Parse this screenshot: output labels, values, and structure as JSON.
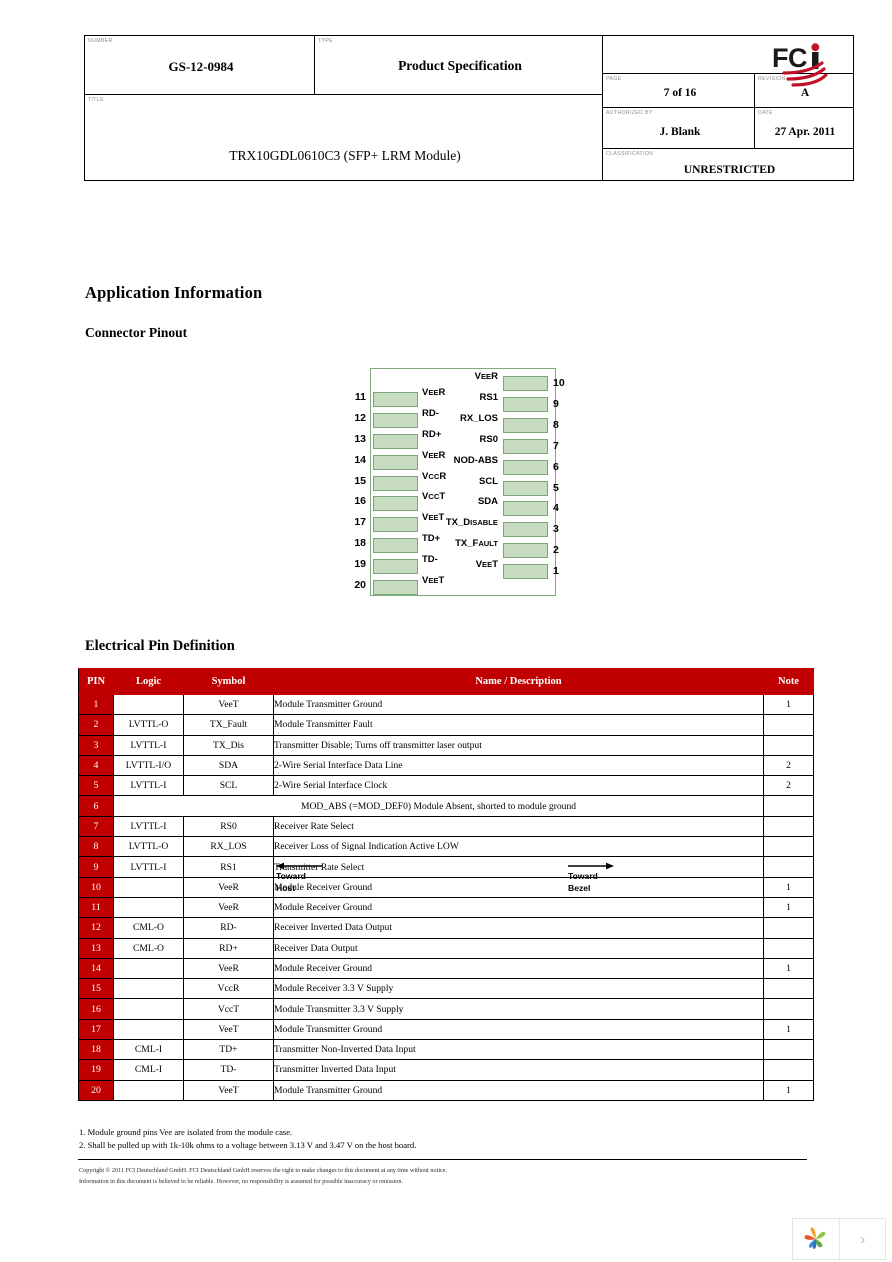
{
  "header": {
    "number_label": "NUMBER",
    "number_value": "GS-12-0984",
    "type_label": "TYPE",
    "type_value": "Product Specification",
    "title_label": "TITLE",
    "title_value": "TRX10GDL0610C3 (SFP+ LRM Module)",
    "page_label": "PAGE",
    "page_value": "7 of 16",
    "revision_label": "REVISION",
    "revision_value": "A",
    "authorized_label": "AUTHORIZED BY",
    "authorized_value": "J. Blank",
    "date_label": "DATE",
    "date_value": "27 Apr. 2011",
    "classification_label": "CLASSIFICATION",
    "classification_value": "UNRESTRICTED",
    "logo_text": "FCI"
  },
  "sections": {
    "application_information": "Application Information",
    "connector_pinout": "Connector Pinout",
    "electrical_pin_definition": "Electrical Pin Definition"
  },
  "pinout": {
    "toward_host_line1": "Toward",
    "toward_host_line2": "Host",
    "toward_bezel_line1": "Toward",
    "toward_bezel_line2": "Bezel",
    "pad_color": "#c8dcc2",
    "pad_border_color": "#7ba676",
    "left_pins": [
      {
        "num": "11",
        "label": "VeeR"
      },
      {
        "num": "12",
        "label": "RD-"
      },
      {
        "num": "13",
        "label": "RD+"
      },
      {
        "num": "14",
        "label": "VeeR"
      },
      {
        "num": "15",
        "label": "VccR"
      },
      {
        "num": "16",
        "label": "VccT"
      },
      {
        "num": "17",
        "label": "VeeT"
      },
      {
        "num": "18",
        "label": "TD+"
      },
      {
        "num": "19",
        "label": "TD-"
      },
      {
        "num": "20",
        "label": "VeeT"
      }
    ],
    "right_pins": [
      {
        "num": "10",
        "label": "VeeR"
      },
      {
        "num": "9",
        "label": "RS1"
      },
      {
        "num": "8",
        "label": "RX_LOS"
      },
      {
        "num": "7",
        "label": "RS0"
      },
      {
        "num": "6",
        "label": "NOD-ABS"
      },
      {
        "num": "5",
        "label": "SCL"
      },
      {
        "num": "4",
        "label": "SDA"
      },
      {
        "num": "3",
        "label": "TX_Disable"
      },
      {
        "num": "2",
        "label": "TX_Fault"
      },
      {
        "num": "1",
        "label": "VeeT"
      }
    ]
  },
  "pin_table": {
    "header_color": "#c00000",
    "columns": [
      "PIN",
      "Logic",
      "Symbol",
      "Name / Description",
      "Note"
    ],
    "rows": [
      {
        "pin": "1",
        "logic": "",
        "symbol": "VeeT",
        "name": "Module Transmitter Ground",
        "note": "1"
      },
      {
        "pin": "2",
        "logic": "LVTTL-O",
        "symbol": "TX_Fault",
        "name": "Module Transmitter Fault",
        "note": ""
      },
      {
        "pin": "3",
        "logic": "LVTTL-I",
        "symbol": "TX_Dis",
        "name": "Transmitter Disable; Turns off transmitter laser output",
        "note": ""
      },
      {
        "pin": "4",
        "logic": "LVTTL-I/O",
        "symbol": "SDA",
        "name": "2-Wire Serial Interface Data Line",
        "note": "2"
      },
      {
        "pin": "5",
        "logic": "LVTTL-I",
        "symbol": "SCL",
        "name": "2-Wire Serial Interface Clock",
        "note": "2"
      },
      {
        "pin": "6",
        "logic": "",
        "symbol": "",
        "name": "",
        "note": "",
        "span_text": "MOD_ABS  (=MOD_DEF0) Module Absent, shorted to module ground",
        "span": true
      },
      {
        "pin": "7",
        "logic": "LVTTL-I",
        "symbol": "RS0",
        "name": "Receiver Rate Select",
        "note": ""
      },
      {
        "pin": "8",
        "logic": "LVTTL-O",
        "symbol": "RX_LOS",
        "name": "Receiver Loss of Signal Indication Active LOW",
        "note": ""
      },
      {
        "pin": "9",
        "logic": "LVTTL-I",
        "symbol": "RS1",
        "name": "Transmitter Rate Select",
        "note": ""
      },
      {
        "pin": "10",
        "logic": "",
        "symbol": "VeeR",
        "name": "Module Receiver Ground",
        "note": "1"
      },
      {
        "pin": "11",
        "logic": "",
        "symbol": "VeeR",
        "name": "Module Receiver Ground",
        "note": "1"
      },
      {
        "pin": "12",
        "logic": "CML-O",
        "symbol": "RD-",
        "name": "Receiver Inverted Data Output",
        "note": ""
      },
      {
        "pin": "13",
        "logic": "CML-O",
        "symbol": "RD+",
        "name": "Receiver Data Output",
        "note": ""
      },
      {
        "pin": "14",
        "logic": "",
        "symbol": "VeeR",
        "name": "Module Receiver Ground",
        "note": "1"
      },
      {
        "pin": "15",
        "logic": "",
        "symbol": "VccR",
        "name": "Module Receiver 3.3 V Supply",
        "note": ""
      },
      {
        "pin": "16",
        "logic": "",
        "symbol": "VccT",
        "name": "Module Transmitter 3.3 V Supply",
        "note": ""
      },
      {
        "pin": "17",
        "logic": "",
        "symbol": "VeeT",
        "name": "Module Transmitter Ground",
        "note": "1"
      },
      {
        "pin": "18",
        "logic": "CML-I",
        "symbol": "TD+",
        "name": "Transmitter Non-Inverted Data Input",
        "note": ""
      },
      {
        "pin": "19",
        "logic": "CML-I",
        "symbol": "TD-",
        "name": "Transmitter Inverted Data Input",
        "note": ""
      },
      {
        "pin": "20",
        "logic": "",
        "symbol": "VeeT",
        "name": "Module Transmitter Ground",
        "note": "1"
      }
    ]
  },
  "notes": {
    "note_1": "1. Module ground pins Vee are isolated from the module case.",
    "note_2": "2. Shall be pulled up with 1k-10k ohms to a voltage between 3.13 V and 3.47 V on the host board."
  },
  "copyright": {
    "line_1": "Copyright © 2011  FCI Deutschland GmbH.  FCI Deutschland GmbH reserves the right to make changes to this document at any time without notice.",
    "line_2": "Information in this document is believed to be reliable.  However, no responsibility is assumed for possible inaccuracy or omission."
  },
  "bottom_widget": {
    "next_glyph": "›"
  }
}
